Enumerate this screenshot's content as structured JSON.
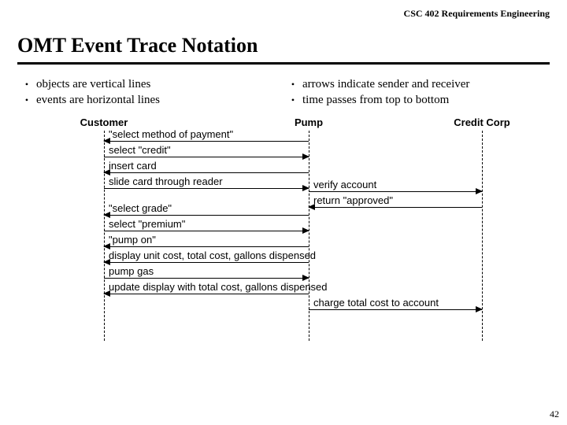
{
  "header": "CSC 402 Requirements Engineering",
  "title": "OMT Event Trace Notation",
  "bullets_left": [
    "objects are vertical lines",
    "events are horizontal lines"
  ],
  "bullets_right": [
    "arrows indicate sender and receiver",
    "time passes from top to bottom"
  ],
  "objects": {
    "customer": "Customer",
    "pump": "Pump",
    "credit": "Credit Corp"
  },
  "messages": {
    "m1": "\"select method of payment\"",
    "m2": "select \"credit\"",
    "m3": "insert card",
    "m4": "slide card through reader",
    "m5": "verify account",
    "m6": "return \"approved\"",
    "m7": "\"select grade\"",
    "m8": "select \"premium\"",
    "m9": "\"pump on\"",
    "m10": "display unit cost, total cost, gallons dispensed",
    "m11": "pump gas",
    "m12": "update display with total cost, gallons dispensed",
    "m13": "charge total cost to account"
  },
  "page": "42"
}
